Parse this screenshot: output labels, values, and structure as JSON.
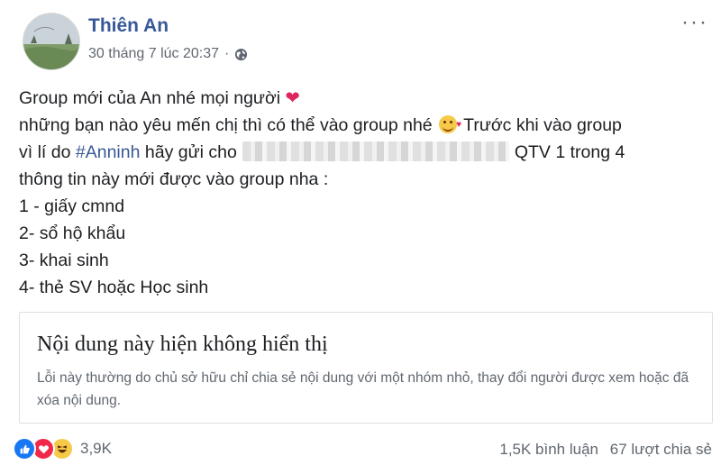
{
  "post": {
    "author": "Thiên An",
    "timestamp": "30 tháng 7 lúc 20:37",
    "separator": "·",
    "privacy_icon": "globe-icon",
    "lines": {
      "l1": "Group mới của An nhé mọi người",
      "l2a": "những bạn nào yêu mến chị thì có thể vào group nhé",
      "l2b": "Trước khi vào group",
      "l3a": "vì lí do",
      "l3_hashtag": "#Anninh",
      "l3b": "hãy gửi cho",
      "l3c": "QTV 1 trong 4",
      "l4": "thông tin này mới được vào group nha :",
      "l5": "1 - giấy cmnd",
      "l6": "2- sổ hộ khẩu",
      "l7": "3- khai sinh",
      "l8": "4- thẻ SV hoặc Học sinh"
    }
  },
  "notice": {
    "title": "Nội dung này hiện không hiển thị",
    "body": "Lỗi này thường do chủ sở hữu chỉ chia sẻ nội dung với một nhóm nhỏ, thay đổi người được xem hoặc đã xóa nội dung."
  },
  "footer": {
    "reaction_count": "3,9K",
    "comments": "1,5K bình luận",
    "shares": "67 lượt chia sẻ"
  },
  "colors": {
    "author_link": "#385898",
    "like": "#1877f2",
    "love": "#f0284a",
    "haha": "#f7c948",
    "muted_text": "#616770"
  }
}
